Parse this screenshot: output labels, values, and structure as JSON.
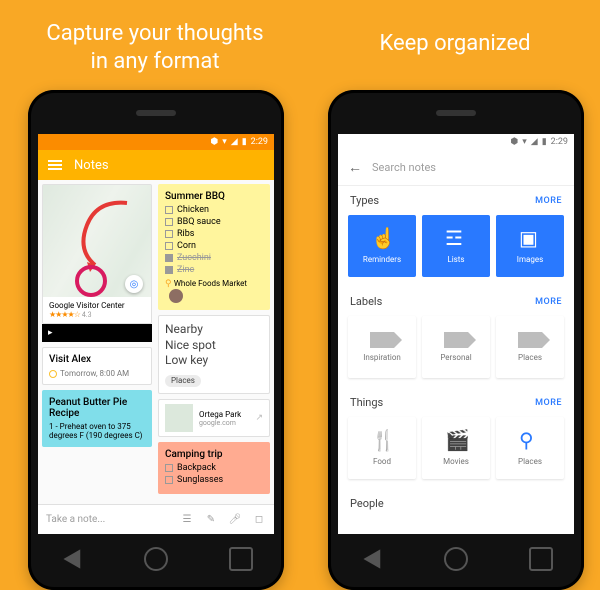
{
  "captions": {
    "left": "Capture your thoughts\nin any format",
    "right": "Keep organized"
  },
  "status": {
    "time": "2:29"
  },
  "leftScreen": {
    "toolbar_title": "Notes",
    "map_place": "Google Visitor Center",
    "map_rating": "4.3",
    "visit": {
      "title": "Visit Alex",
      "reminder": "Tomorrow, 8:00 AM"
    },
    "recipe": {
      "title": "Peanut Butter Pie Recipe",
      "body": "1 - Preheat oven to 375 degrees F (190 degrees C)"
    },
    "bbq": {
      "title": "Summer BBQ",
      "items": [
        "Chicken",
        "BBQ sauce",
        "Ribs",
        "Corn",
        "Zucchini",
        "Zinc"
      ],
      "location": "Whole Foods Market"
    },
    "nearby": {
      "l1": "Nearby",
      "l2": "Nice spot",
      "l3": "Low key",
      "tag": "Places"
    },
    "ortega": {
      "name": "Ortega Park",
      "url": "google.com"
    },
    "camping": {
      "title": "Camping trip",
      "items": [
        "Backpack",
        "Sunglasses"
      ]
    },
    "bottombar_placeholder": "Take a note..."
  },
  "rightScreen": {
    "search_placeholder": "Search notes",
    "sections": {
      "types": {
        "title": "Types",
        "more": "MORE",
        "tiles": [
          "Reminders",
          "Lists",
          "Images"
        ]
      },
      "labels": {
        "title": "Labels",
        "more": "MORE",
        "tiles": [
          "Inspiration",
          "Personal",
          "Places"
        ]
      },
      "things": {
        "title": "Things",
        "more": "MORE",
        "tiles": [
          "Food",
          "Movies",
          "Places"
        ]
      },
      "people": {
        "title": "People"
      }
    }
  }
}
